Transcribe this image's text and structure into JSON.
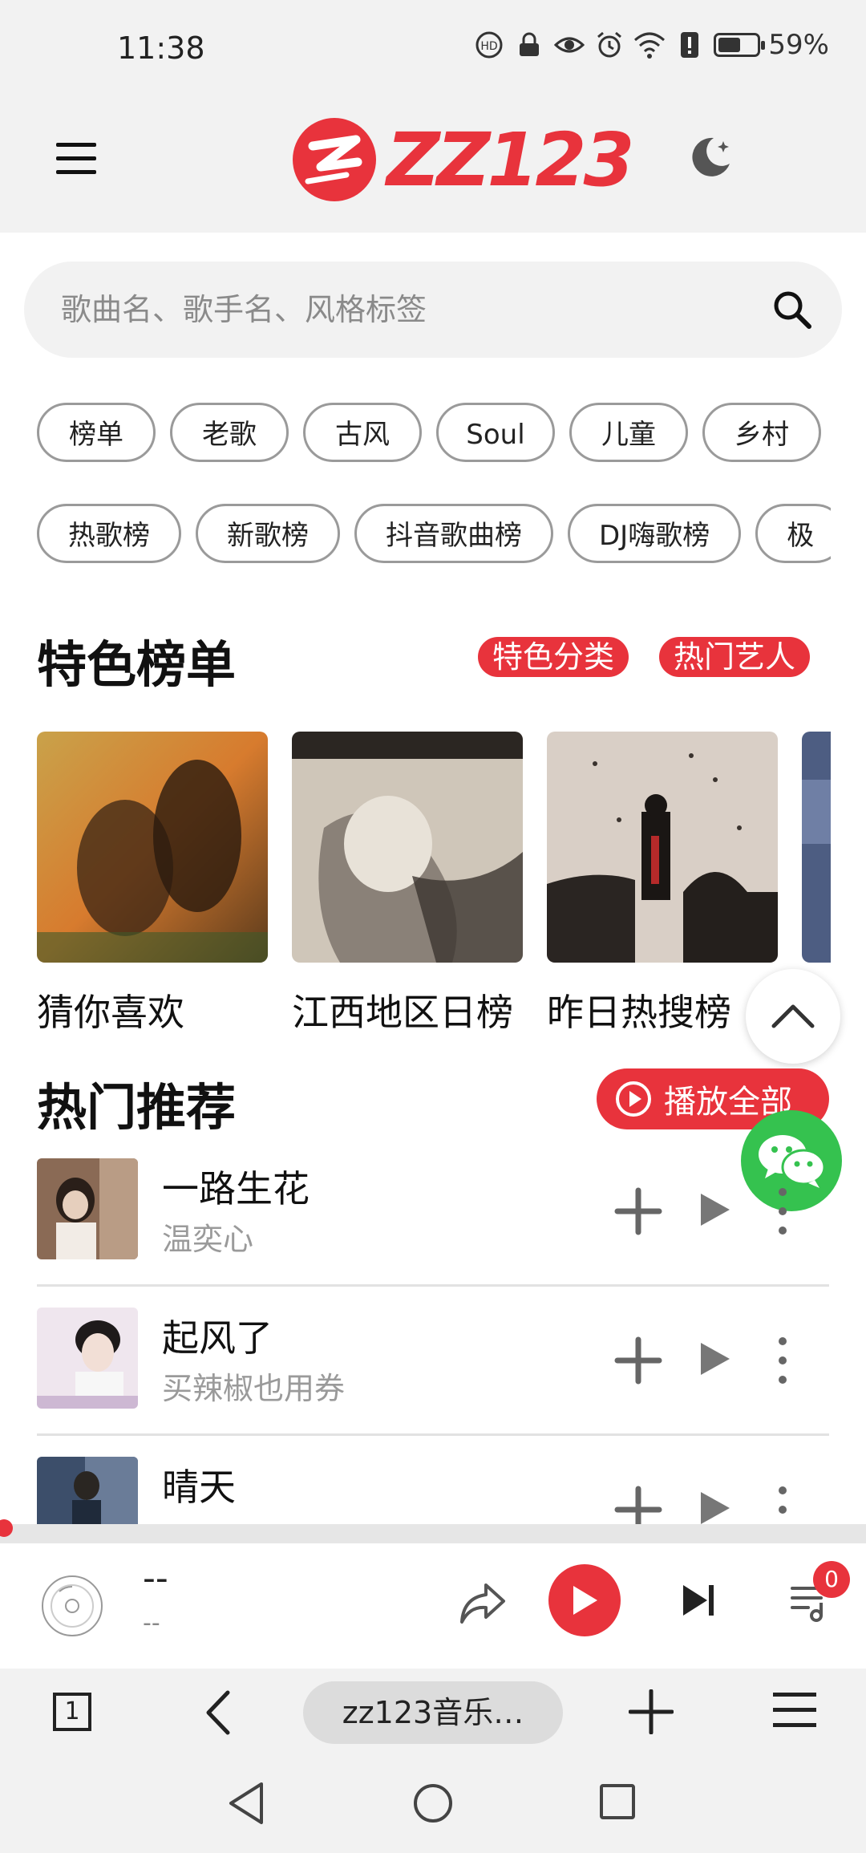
{
  "status_bar": {
    "time": "11:38",
    "battery_percent": "59%",
    "battery_level": 0.59
  },
  "header": {
    "logo_text": "ZZ123"
  },
  "search": {
    "placeholder": "歌曲名、歌手名、风格标签"
  },
  "chips_row1": [
    "榜单",
    "老歌",
    "古风",
    "Soul",
    "儿童",
    "乡村"
  ],
  "chips_row2": [
    "热歌榜",
    "新歌榜",
    "抖音歌曲榜",
    "DJ嗨歌榜",
    "极"
  ],
  "featured": {
    "title": "特色榜单",
    "tag1": "特色分类",
    "tag2": "热门艺人",
    "cards": [
      {
        "label": "猜你喜欢"
      },
      {
        "label": "江西地区日榜"
      },
      {
        "label": "昨日热搜榜"
      }
    ]
  },
  "hot": {
    "title": "热门推荐",
    "play_all": "播放全部",
    "songs": [
      {
        "title": "一路生花",
        "artist": "温奕心"
      },
      {
        "title": "起风了",
        "artist": "买辣椒也用券"
      },
      {
        "title": "晴天",
        "artist": ""
      }
    ]
  },
  "player": {
    "title": "--",
    "artist": "--",
    "queue_count": "0"
  },
  "browser": {
    "tab_count": "1",
    "url_title": "zz123音乐…"
  },
  "colors": {
    "accent": "#e8333c",
    "wechat": "#35c24f",
    "chrome_bg": "#f2f2f2"
  }
}
